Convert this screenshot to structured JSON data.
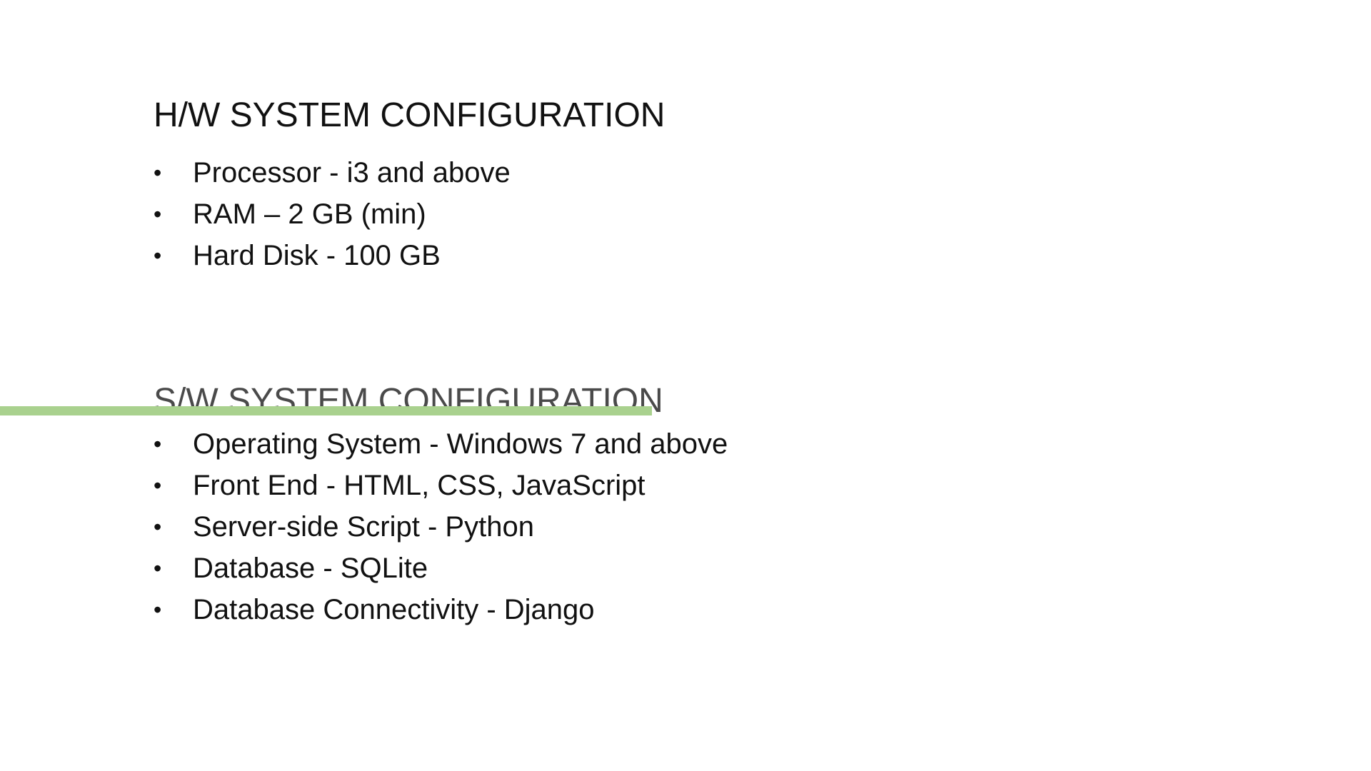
{
  "colors": {
    "accent": "#a9d18e",
    "text": "#111111",
    "heading_faded": "#4a4a4a",
    "background": "#ffffff"
  },
  "bullet_glyph": "•",
  "hardware": {
    "title": "H/W SYSTEM CONFIGURATION",
    "items": [
      "Processor - i3 and above",
      "RAM – 2 GB (min)",
      "Hard Disk - 100 GB"
    ]
  },
  "software": {
    "title": "S/W SYSTEM CONFIGURATION",
    "items": [
      "Operating System - Windows 7 and above",
      "Front End - HTML, CSS, JavaScript",
      "Server-side Script - Python",
      "Database - SQLite",
      "Database Connectivity - Django"
    ]
  }
}
